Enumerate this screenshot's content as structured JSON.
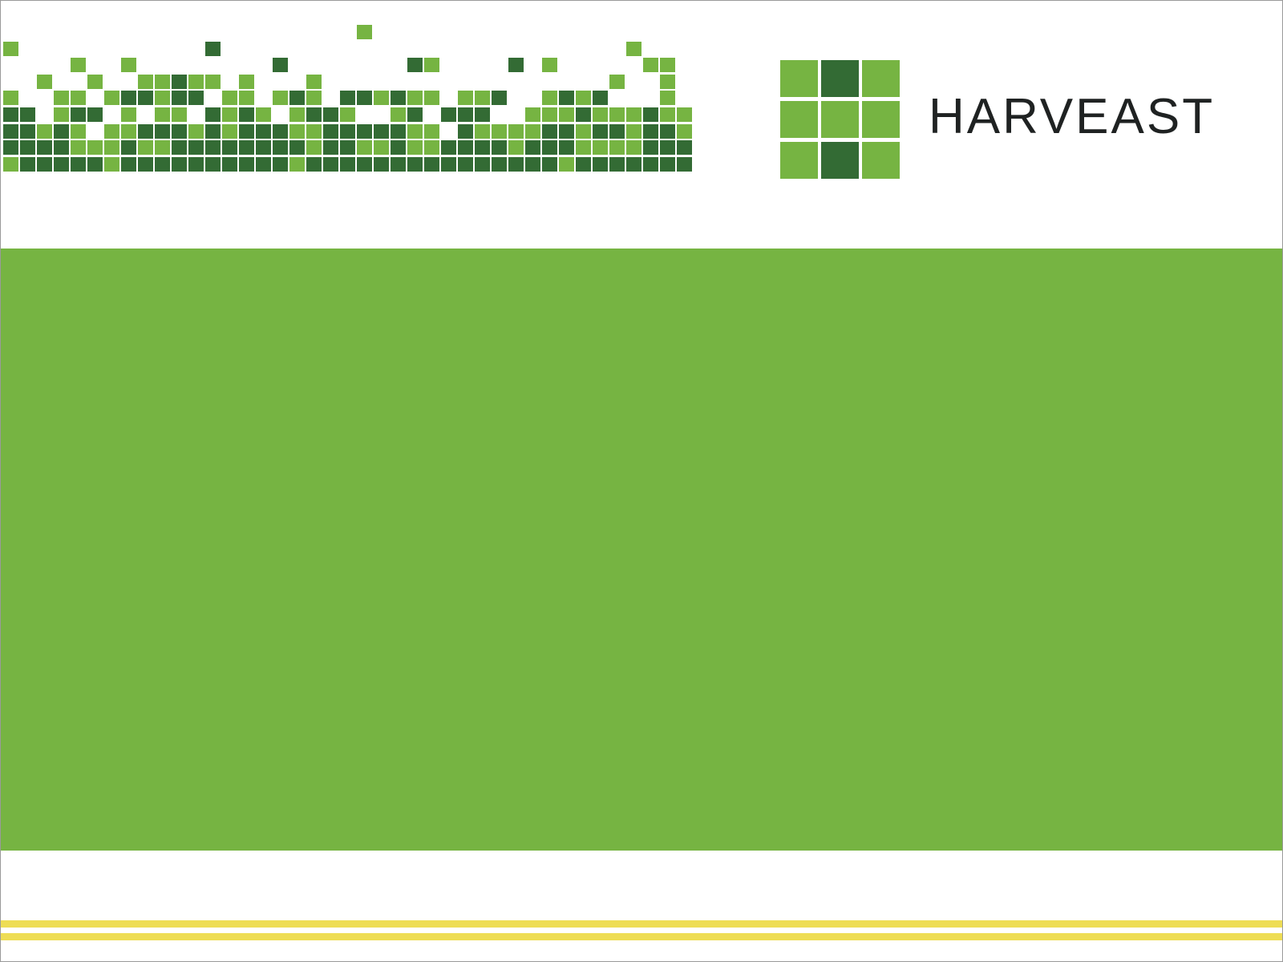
{
  "brand": {
    "name": "HARVEAST",
    "mark_pattern": [
      "light",
      "dark",
      "light",
      "light",
      "light",
      "light",
      "light",
      "dark",
      "light"
    ]
  },
  "colors": {
    "light_green": "#76b442",
    "dark_green": "#336b34",
    "brand_text": "#1f2222",
    "band_green": "#76b442",
    "stripe_yellow": "#eedd55",
    "frame_border": "#9a9a9a"
  }
}
